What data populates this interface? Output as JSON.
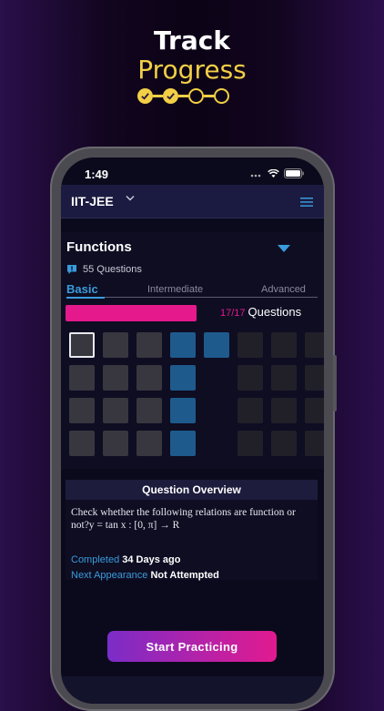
{
  "promo": {
    "title": "Track",
    "subtitle": "Progress",
    "steps": [
      "done",
      "done",
      "todo",
      "todo"
    ]
  },
  "status": {
    "time": "1:49"
  },
  "appbar": {
    "exam": "IIT-JEE"
  },
  "topic": {
    "name": "Functions",
    "question_count": "55 Questions",
    "tabs": [
      {
        "label": "Basic",
        "active": true
      },
      {
        "label": "Intermediate",
        "active": false
      },
      {
        "label": "Advanced",
        "active": false
      }
    ],
    "progress": {
      "fraction": 1.0,
      "count": "17/17",
      "label": "Questions"
    },
    "grid_rows": [
      [
        "selected",
        "gray",
        "gray",
        "blue",
        "blue",
        "dark",
        "dark",
        "dark"
      ],
      [
        "gray",
        "gray",
        "gray",
        "blue",
        "empty",
        "dark",
        "dark",
        "dark"
      ],
      [
        "gray",
        "gray",
        "gray",
        "blue",
        "empty",
        "dark",
        "dark",
        "dark"
      ],
      [
        "gray",
        "gray",
        "gray",
        "blue",
        "empty",
        "dark",
        "dark",
        "dark"
      ]
    ],
    "colors": {
      "gray": "#38373f",
      "blue": "#1f5a8c",
      "dark": "#212029",
      "accent": "#3a9bdc",
      "pink": "#e5198c"
    }
  },
  "overview": {
    "title": "Question Overview",
    "question_text": "Check whether the following relations are function or not?y = tan x : [0, π] → R",
    "completed_label": "Completed",
    "completed_value": "34 Days ago",
    "next_label": "Next Appearance",
    "next_value": "Not Attempted"
  },
  "cta": {
    "label": "Start Practicing"
  }
}
